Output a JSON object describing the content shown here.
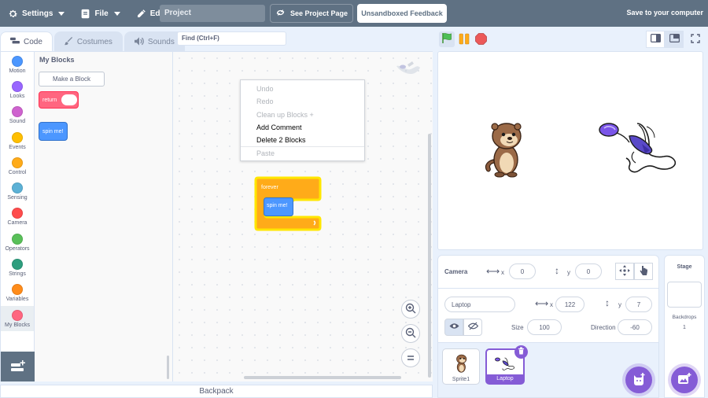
{
  "menubar": {
    "settings_label": "Settings",
    "file_label": "File",
    "edit_label": "Edit",
    "project_title": "Project",
    "see_project_label": "See Project Page",
    "feedback_label": "Unsandboxed Feedback",
    "save_label": "Save to your computer"
  },
  "tabs": [
    {
      "label": "Code",
      "icon": "code-icon",
      "active": true
    },
    {
      "label": "Costumes",
      "icon": "brush-icon",
      "active": false
    },
    {
      "label": "Sounds",
      "icon": "speaker-icon",
      "active": false
    }
  ],
  "search": {
    "placeholder": "Find (Ctrl+F)"
  },
  "categories": [
    {
      "label": "Motion",
      "color": "#4c97ff"
    },
    {
      "label": "Looks",
      "color": "#9966ff"
    },
    {
      "label": "Sound",
      "color": "#cf63cf"
    },
    {
      "label": "Events",
      "color": "#ffbf00"
    },
    {
      "label": "Control",
      "color": "#ffab19"
    },
    {
      "label": "Sensing",
      "color": "#5cb1d6"
    },
    {
      "label": "Camera",
      "color": "#ff4c4c"
    },
    {
      "label": "Operators",
      "color": "#59c059"
    },
    {
      "label": "Strings",
      "color": "#2e9e7e"
    },
    {
      "label": "Variables",
      "color": "#ff8c1a"
    },
    {
      "label": "My Blocks",
      "color": "#ff6680"
    }
  ],
  "palette": {
    "title": "My Blocks",
    "make_block_label": "Make a Block",
    "return_block_label": "return",
    "spin_block_label": "spin me!"
  },
  "context_menu": [
    {
      "label": "Undo",
      "disabled": true
    },
    {
      "label": "Redo",
      "disabled": true
    },
    {
      "label": "Clean up Blocks +",
      "disabled": true
    },
    {
      "label": "Add Comment",
      "disabled": false
    },
    {
      "label": "Delete 2 Blocks",
      "disabled": false
    },
    {
      "label": "Paste",
      "disabled": true
    }
  ],
  "script": {
    "forever_label": "forever",
    "inner_label": "spin me!"
  },
  "backpack_label": "Backpack",
  "camera": {
    "label": "Camera",
    "x_label": "x",
    "x_value": "0",
    "y_label": "y",
    "y_value": "0"
  },
  "sprite": {
    "name": "Laptop",
    "x_label": "x",
    "x_value": "122",
    "y_label": "y",
    "y_value": "7",
    "size_label": "Size",
    "size_value": "100",
    "direction_label": "Direction",
    "direction_value": "-60"
  },
  "sprites": [
    {
      "name": "Sprite1",
      "selected": false
    },
    {
      "name": "Laptop",
      "selected": true
    }
  ],
  "stage_pane": {
    "title": "Stage",
    "backdrops_label": "Backdrops",
    "backdrops_count": "1"
  },
  "colors": {
    "menubar": "#5f7183",
    "accent": "#855cd6",
    "control_block": "#ffab19",
    "custom_block": "#ff6680"
  }
}
